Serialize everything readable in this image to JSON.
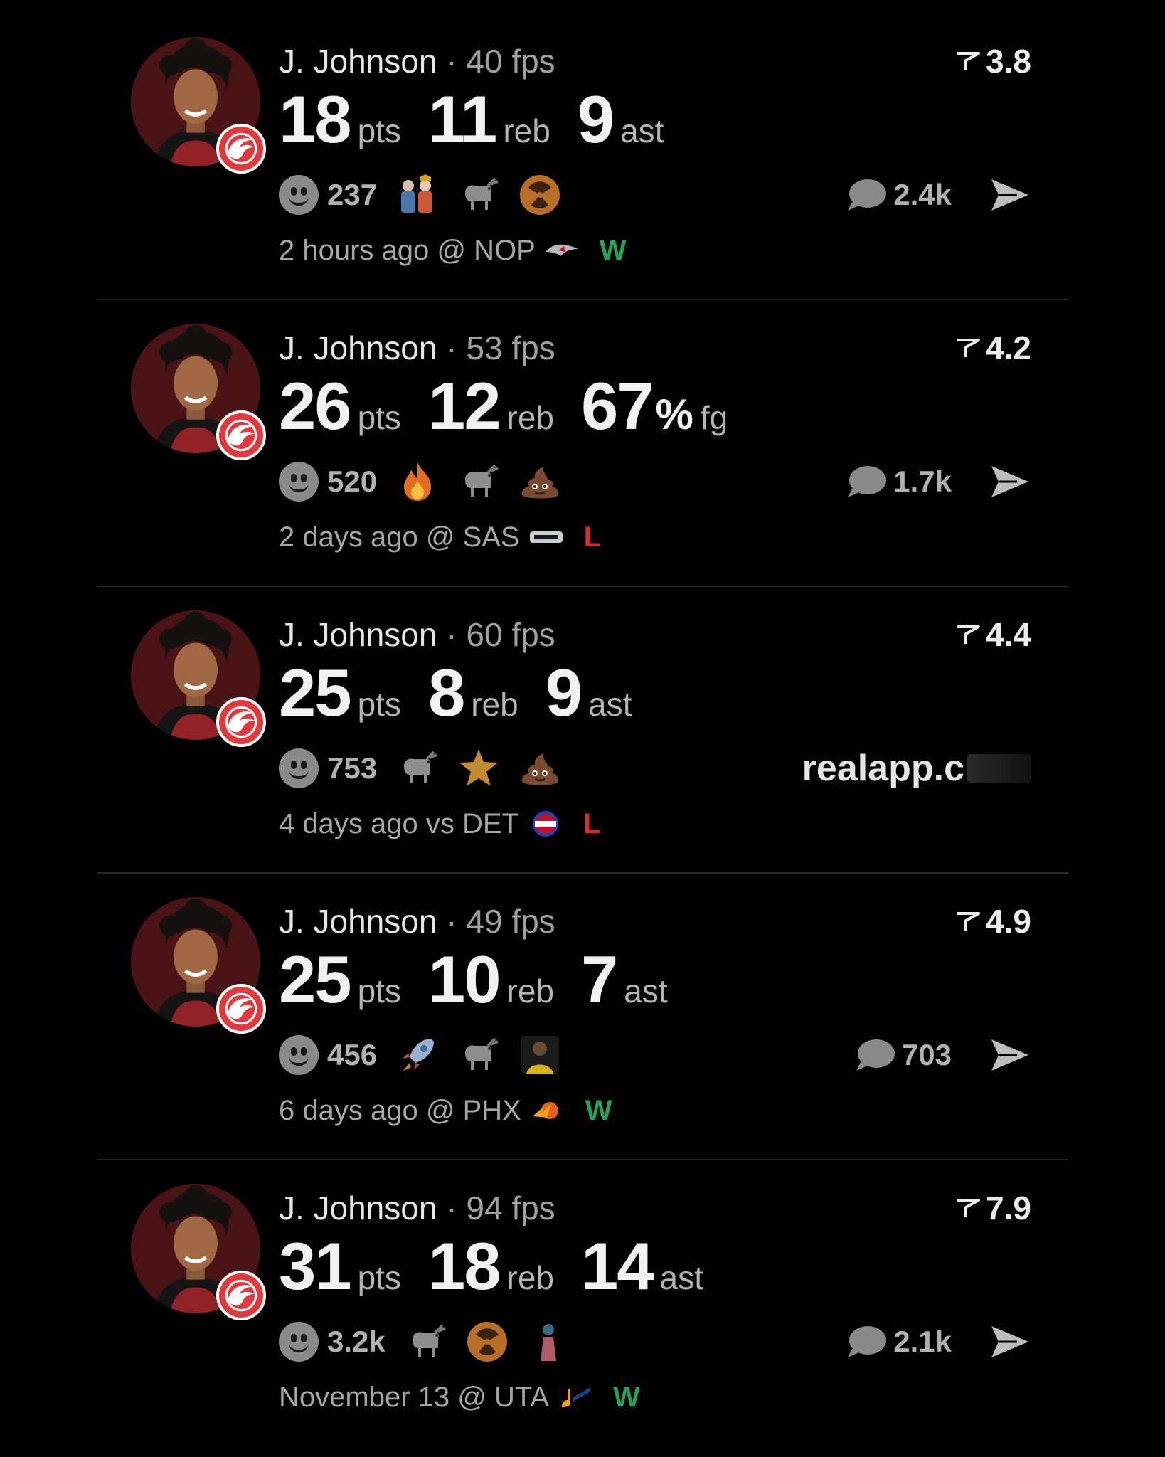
{
  "colors": {
    "background": "#000000",
    "win": "#22a45a",
    "loss": "#e0282c",
    "team_red": "#e03a3e"
  },
  "posts": [
    {
      "player": "J. Johnson",
      "fps": "40 fps",
      "rating": "3.8",
      "stats": [
        {
          "num": "18",
          "pct": "",
          "unit": "pts"
        },
        {
          "num": "11",
          "pct": "",
          "unit": "reb"
        },
        {
          "num": "9",
          "pct": "",
          "unit": "ast"
        }
      ],
      "reactions": "237",
      "emojis": [
        "couple-figurines",
        "goat",
        "radioactive"
      ],
      "comments": "2.4k",
      "time": "2 hours ago",
      "loc": "@",
      "opponent": "NOP",
      "opponent_logo": "pelican-logo",
      "result": "W"
    },
    {
      "player": "J. Johnson",
      "fps": "53 fps",
      "rating": "4.2",
      "stats": [
        {
          "num": "26",
          "pct": "",
          "unit": "pts"
        },
        {
          "num": "12",
          "pct": "",
          "unit": "reb"
        },
        {
          "num": "67",
          "pct": "%",
          "unit": "fg"
        }
      ],
      "reactions": "520",
      "emojis": [
        "fire",
        "goat",
        "poop"
      ],
      "comments": "1.7k",
      "time": "2 days ago",
      "loc": "@",
      "opponent": "SAS",
      "opponent_logo": "spurs-logo",
      "result": "L"
    },
    {
      "player": "J. Johnson",
      "fps": "60 fps",
      "rating": "4.4",
      "stats": [
        {
          "num": "25",
          "pct": "",
          "unit": "pts"
        },
        {
          "num": "8",
          "pct": "",
          "unit": "reb"
        },
        {
          "num": "9",
          "pct": "",
          "unit": "ast"
        }
      ],
      "reactions": "753",
      "emojis": [
        "goat",
        "star",
        "poop"
      ],
      "watermark": "realapp.c",
      "time": "4 days ago",
      "loc": "vs",
      "opponent": "DET",
      "opponent_logo": "pistons-logo",
      "result": "L"
    },
    {
      "player": "J. Johnson",
      "fps": "49 fps",
      "rating": "4.9",
      "stats": [
        {
          "num": "25",
          "pct": "",
          "unit": "pts"
        },
        {
          "num": "10",
          "pct": "",
          "unit": "reb"
        },
        {
          "num": "7",
          "pct": "",
          "unit": "ast"
        }
      ],
      "reactions": "456",
      "emojis": [
        "rocket",
        "goat",
        "player-photo"
      ],
      "comments": "703",
      "time": "6 days ago",
      "loc": "@",
      "opponent": "PHX",
      "opponent_logo": "suns-logo",
      "result": "W"
    },
    {
      "player": "J. Johnson",
      "fps": "94 fps",
      "rating": "7.9",
      "stats": [
        {
          "num": "31",
          "pct": "",
          "unit": "pts"
        },
        {
          "num": "18",
          "pct": "",
          "unit": "reb"
        },
        {
          "num": "14",
          "pct": "",
          "unit": "ast"
        }
      ],
      "reactions": "3.2k",
      "emojis": [
        "goat",
        "radioactive",
        "figure"
      ],
      "comments": "2.1k",
      "time": "November 13",
      "loc": "@",
      "opponent": "UTA",
      "opponent_logo": "jazz-logo",
      "result": "W"
    }
  ]
}
